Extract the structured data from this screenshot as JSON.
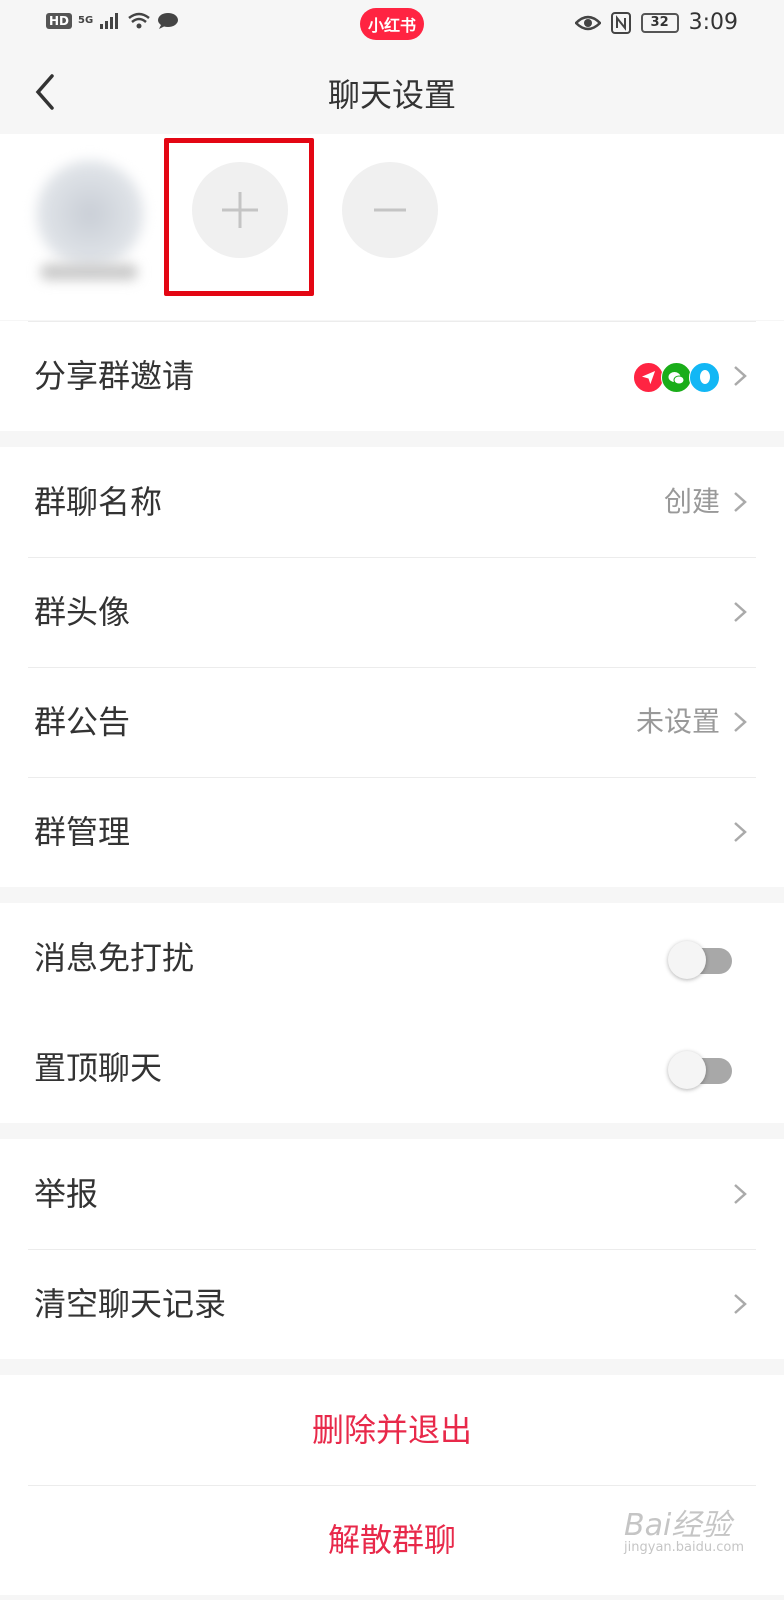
{
  "status_bar": {
    "hd": "HD",
    "network": "5G",
    "app_badge": "小红书",
    "battery": "32",
    "time": "3:09"
  },
  "nav": {
    "title": "聊天设置"
  },
  "rows": {
    "share": {
      "label": "分享群邀请"
    },
    "group_name": {
      "label": "群聊名称",
      "value": "创建"
    },
    "group_avatar": {
      "label": "群头像"
    },
    "announcement": {
      "label": "群公告",
      "value": "未设置"
    },
    "management": {
      "label": "群管理"
    },
    "mute": {
      "label": "消息免打扰",
      "enabled": false
    },
    "pin": {
      "label": "置顶聊天",
      "enabled": false
    },
    "report": {
      "label": "举报"
    },
    "clear": {
      "label": "清空聊天记录"
    }
  },
  "actions": {
    "delete_exit": "删除并退出",
    "dissolve": "解散群聊"
  },
  "watermark": {
    "brand": "Bai经验",
    "url": "jingyan.baidu.com"
  },
  "colors": {
    "accent_red": "#e8294a",
    "highlight": "#e30613",
    "badge_red": "#ff2442"
  }
}
